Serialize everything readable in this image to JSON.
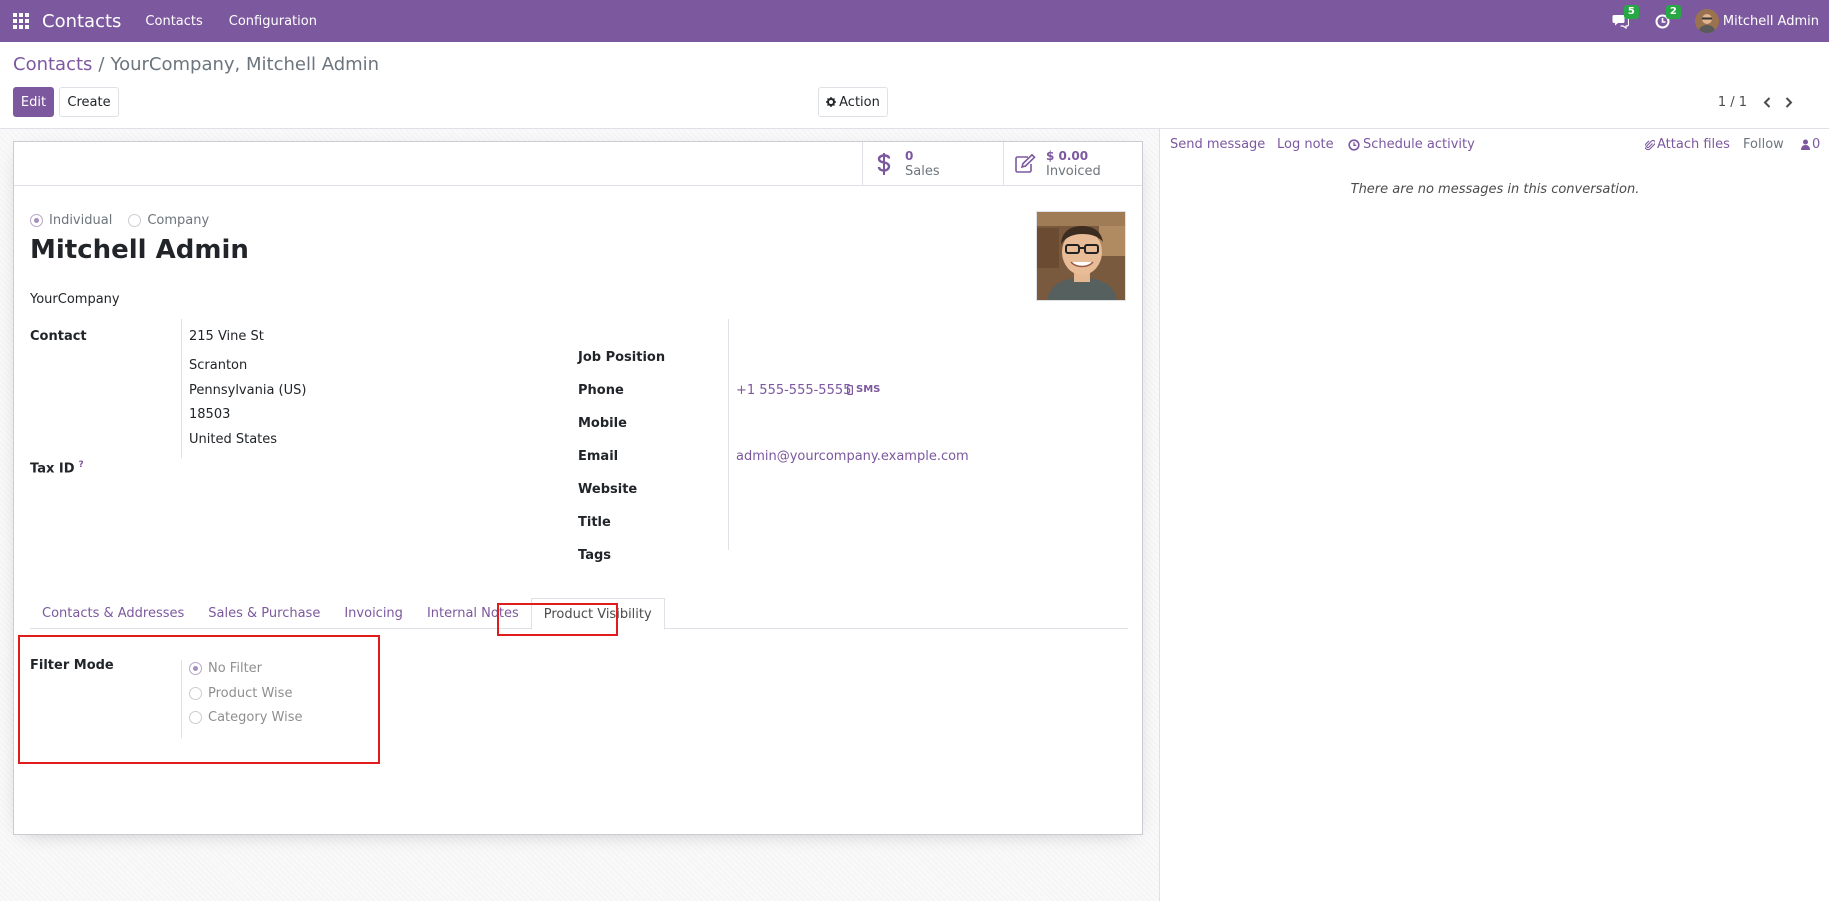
{
  "navbar": {
    "brand": "Contacts",
    "menu": [
      "Contacts",
      "Configuration"
    ],
    "messages_badge": "5",
    "activities_badge": "2",
    "user_name": "Mitchell Admin"
  },
  "breadcrumb": {
    "parent": "Contacts",
    "separator": "/",
    "current": "YourCompany, Mitchell Admin"
  },
  "toolbar": {
    "edit_label": "Edit",
    "create_label": "Create",
    "action_label": "Action",
    "pager": "1 / 1"
  },
  "stat_buttons": {
    "sales": {
      "value": "0",
      "label": "Sales"
    },
    "invoiced": {
      "value": "$ 0.00",
      "label": "Invoiced"
    }
  },
  "partner": {
    "type_options": [
      "Individual",
      "Company"
    ],
    "type_selected": "Individual",
    "name": "Mitchell Admin",
    "company": "YourCompany"
  },
  "fields_left": {
    "contact_label": "Contact",
    "address": [
      "215 Vine St",
      "Scranton",
      "Pennsylvania (US)",
      "18503",
      "United States"
    ],
    "tax_id_label": "Tax ID",
    "tax_help": "?"
  },
  "fields_right": {
    "job_position_label": "Job Position",
    "phone_label": "Phone",
    "phone_value": "+1 555-555-5555",
    "sms_label": "SMS",
    "mobile_label": "Mobile",
    "email_label": "Email",
    "email_value": "admin@yourcompany.example.com",
    "website_label": "Website",
    "title_label": "Title",
    "tags_label": "Tags"
  },
  "tabs": [
    "Contacts & Addresses",
    "Sales & Purchase",
    "Invoicing",
    "Internal Notes",
    "Product Visibility"
  ],
  "active_tab": "Product Visibility",
  "product_visibility": {
    "filter_mode_label": "Filter Mode",
    "options": [
      "No Filter",
      "Product Wise",
      "Category Wise"
    ],
    "selected": "No Filter"
  },
  "chatter": {
    "send_message": "Send message",
    "log_note": "Log note",
    "schedule_activity": "Schedule activity",
    "attach_files": "Attach files",
    "follow": "Follow",
    "followers_count": "0",
    "empty_text": "There are no messages in this conversation."
  },
  "colors": {
    "brand": "#7c589f",
    "badge": "#28a745",
    "highlight": "#e01c1c"
  },
  "icons": [
    "apps-grid-icon",
    "chat-icon",
    "clock-icon",
    "dollar-icon",
    "edit-icon",
    "gear-icon",
    "chevron-left-icon",
    "chevron-right-icon",
    "mobile-icon",
    "paperclip-icon",
    "user-icon"
  ]
}
